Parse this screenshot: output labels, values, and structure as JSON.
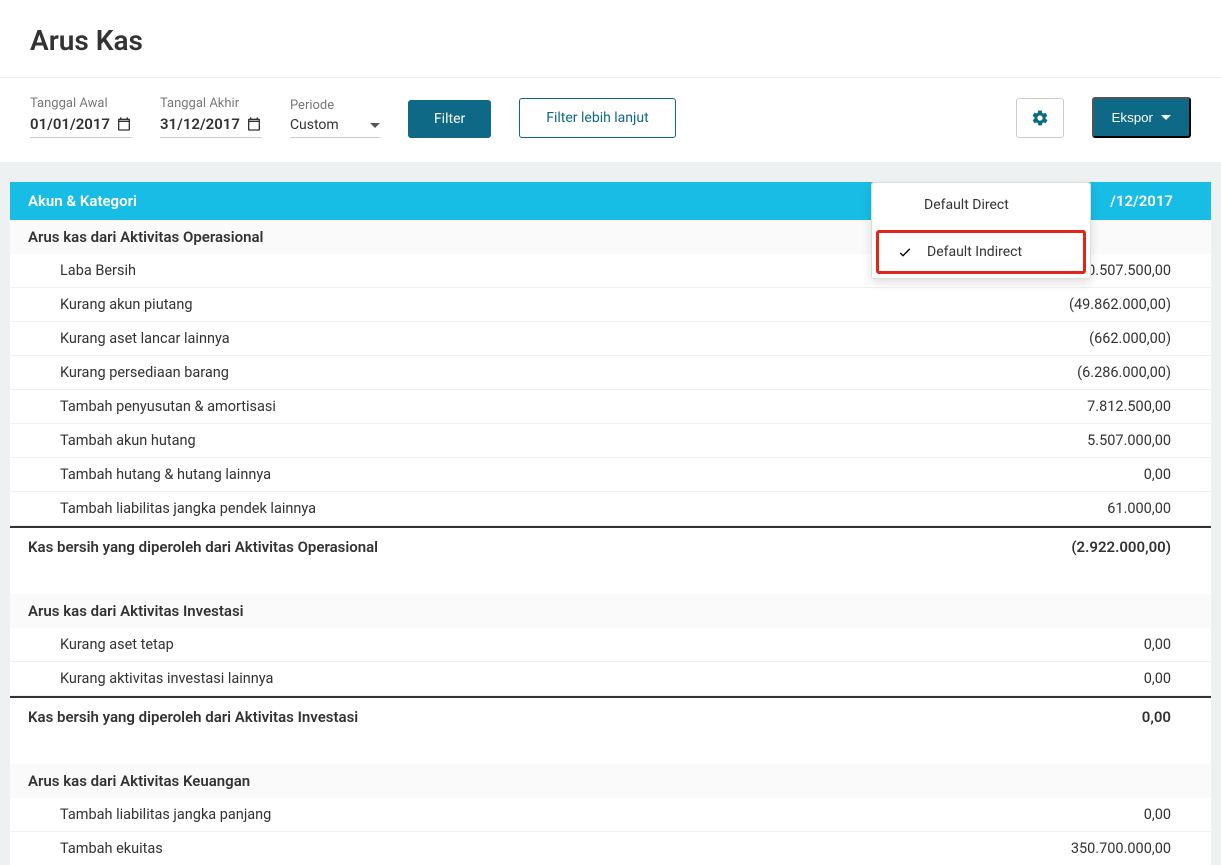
{
  "pageTitle": "Arus Kas",
  "filters": {
    "startDate": {
      "label": "Tanggal Awal",
      "value": "01/01/2017"
    },
    "endDate": {
      "label": "Tanggal Akhir",
      "value": "31/12/2017"
    },
    "period": {
      "label": "Periode",
      "value": "Custom"
    },
    "filterBtn": "Filter",
    "moreFilterBtn": "Filter lebih lanjut",
    "exportBtn": "Ekspor"
  },
  "settingsMenu": {
    "direct": "Default Direct",
    "indirect": "Default Indirect"
  },
  "table": {
    "header": {
      "label": "Akun & Kategori",
      "value": "/12/2017"
    },
    "sections": [
      {
        "title": "Arus kas dari Aktivitas Operasional",
        "rows": [
          {
            "label": "Laba Bersih",
            "value": "40.507.500,00"
          },
          {
            "label": "Kurang akun piutang",
            "value": "(49.862.000,00)"
          },
          {
            "label": "Kurang aset lancar lainnya",
            "value": "(662.000,00)"
          },
          {
            "label": "Kurang persediaan barang",
            "value": "(6.286.000,00)"
          },
          {
            "label": "Tambah penyusutan & amortisasi",
            "value": "7.812.500,00"
          },
          {
            "label": "Tambah akun hutang",
            "value": "5.507.000,00"
          },
          {
            "label": "Tambah hutang & hutang lainnya",
            "value": "0,00"
          },
          {
            "label": "Tambah liabilitas jangka pendek lainnya",
            "value": "61.000,00"
          }
        ],
        "total": {
          "label": "Kas bersih yang diperoleh dari Aktivitas Operasional",
          "value": "(2.922.000,00)"
        }
      },
      {
        "title": "Arus kas dari Aktivitas Investasi",
        "rows": [
          {
            "label": "Kurang aset tetap",
            "value": "0,00"
          },
          {
            "label": "Kurang aktivitas investasi lainnya",
            "value": "0,00"
          }
        ],
        "total": {
          "label": "Kas bersih yang diperoleh dari Aktivitas Investasi",
          "value": "0,00"
        }
      },
      {
        "title": "Arus kas dari Aktivitas Keuangan",
        "rows": [
          {
            "label": "Tambah liabilitas jangka panjang",
            "value": "0,00"
          },
          {
            "label": "Tambah ekuitas",
            "value": "350.700.000,00"
          }
        ]
      }
    ]
  }
}
